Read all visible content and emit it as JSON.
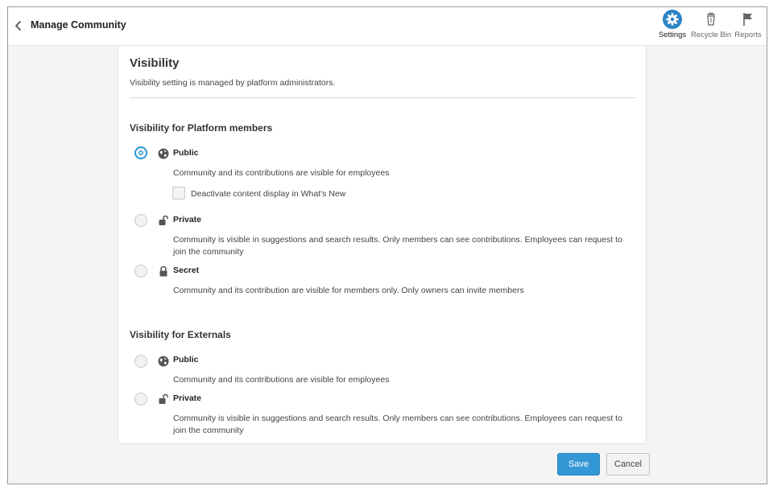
{
  "header": {
    "title": "Manage Community",
    "actions": [
      {
        "label": "Settings",
        "icon": "gear-icon",
        "active": true
      },
      {
        "label": "Recycle Bin",
        "icon": "recycle-bin-icon",
        "active": false
      },
      {
        "label": "Reports",
        "icon": "flag-icon",
        "active": false
      }
    ]
  },
  "card": {
    "title": "Visibility",
    "subtitle": "Visibility setting is managed by platform administrators.",
    "platform": {
      "heading": "Visibility for Platform members",
      "options": [
        {
          "label": "Public",
          "icon": "globe-icon",
          "selected": true,
          "description": "Community and its contributions are visible for employees"
        },
        {
          "label": "Private",
          "icon": "unlocked-padlock-icon",
          "selected": false,
          "description": "Community is visible in suggestions and search results. Only members can see contributions. Employees can request to join the community"
        },
        {
          "label": "Secret",
          "icon": "padlock-icon",
          "selected": false,
          "description": "Community and its contribution are visible for members only. Only owners can invite members"
        }
      ],
      "checkbox": {
        "label": "Deactivate content display in What's New",
        "checked": false
      }
    },
    "externals": {
      "heading": "Visibility for Externals",
      "options": [
        {
          "label": "Public",
          "icon": "globe-icon",
          "selected": false,
          "description": "Community and its contributions are visible for employees"
        },
        {
          "label": "Private",
          "icon": "unlocked-padlock-icon",
          "selected": false,
          "description": "Community is visible in suggestions and search results. Only members can see contributions. Employees can request to join the community"
        }
      ]
    }
  },
  "footer": {
    "save_label": "Save",
    "cancel_label": "Cancel"
  },
  "colors": {
    "accent": "#3598d6",
    "background": "#f4f4f4"
  }
}
